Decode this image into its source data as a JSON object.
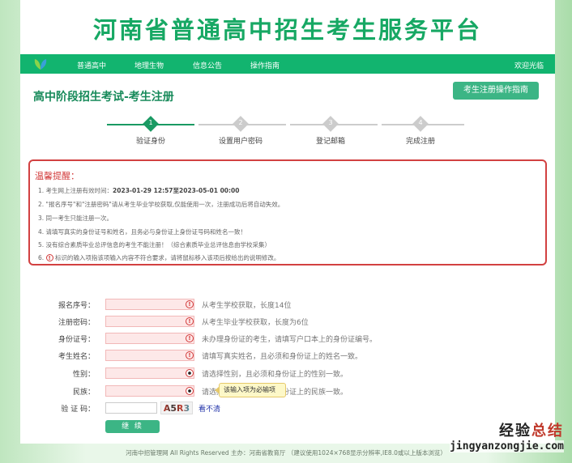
{
  "header": {
    "title": "河南省普通高中招生考生服务平台"
  },
  "nav": {
    "items": [
      "普通高中",
      "地理生物",
      "信息公告",
      "操作指南"
    ],
    "welcome": "欢迎光临"
  },
  "main": {
    "heading": "高中阶段招生考试-考生注册",
    "guide_button": "考生注册操作指南"
  },
  "steps": [
    {
      "num": "1",
      "label": "验证身份",
      "active": true
    },
    {
      "num": "2",
      "label": "设置用户密码",
      "active": false
    },
    {
      "num": "3",
      "label": "登记邮箱",
      "active": false
    },
    {
      "num": "4",
      "label": "完成注册",
      "active": false
    }
  ],
  "notice": {
    "title": "温馨提醒：",
    "lines": [
      "1. 考生网上注册有效时间：",
      "2. \"报名序号\"和\"注册密码\"请从考生毕业学校获取,仅能使用一次，注册成功后将自动失效。",
      "3. 同一考生只能注册一次。",
      "4. 请填写真实的身份证号和姓名，且务必与身份证上身份证号码和姓名一致！",
      "5. 没有综合素质毕业总评信息的考生不能注册！（综合素质毕业总评信息由学校采集）",
      "6. "
    ],
    "time_range": "2023-01-29 12:57至2023-05-01 00:00",
    "line6_rest": "标识的输入项指该项输入内容不符合要求，请将鼠标移入该项后按给出的说明修改。",
    "warn_symbol": "!"
  },
  "form": {
    "fields": [
      {
        "label": "报名序号：",
        "hint": "从考生学校获取，长度14位"
      },
      {
        "label": "注册密码：",
        "hint": "从考生毕业学校获取，长度为6位"
      },
      {
        "label": "身份证号：",
        "hint": "未办理身份证的考生，请填写户口本上的身份证编号。"
      },
      {
        "label": "考生姓名：",
        "hint": "请填写真实姓名，且必须和身份证上的姓名一致。"
      },
      {
        "label": "性别：",
        "hint": "请选择性别，且必须和身份证上的性别一致。"
      },
      {
        "label": "民族：",
        "hint": "请选择民族，且必须和身份证上的民族一致。"
      }
    ],
    "tooltip": "该输入项为必输项",
    "captcha_label": "验 证 码：",
    "captcha_value": "",
    "captcha_text": "A5R3",
    "captcha_refresh": "看不清",
    "submit": "继 续"
  },
  "footer": {
    "text": "河南中招管理网 All Rights Reserved 主办：河南省教育厅 （建议使用1024×768显示分辨率,IE8.0或以上版本浏览）"
  },
  "watermark": {
    "line1": "经验总结",
    "line2": "jingyanzongjie.com"
  },
  "colors": {
    "brand": "#12b46f",
    "alert": "#d24141"
  }
}
